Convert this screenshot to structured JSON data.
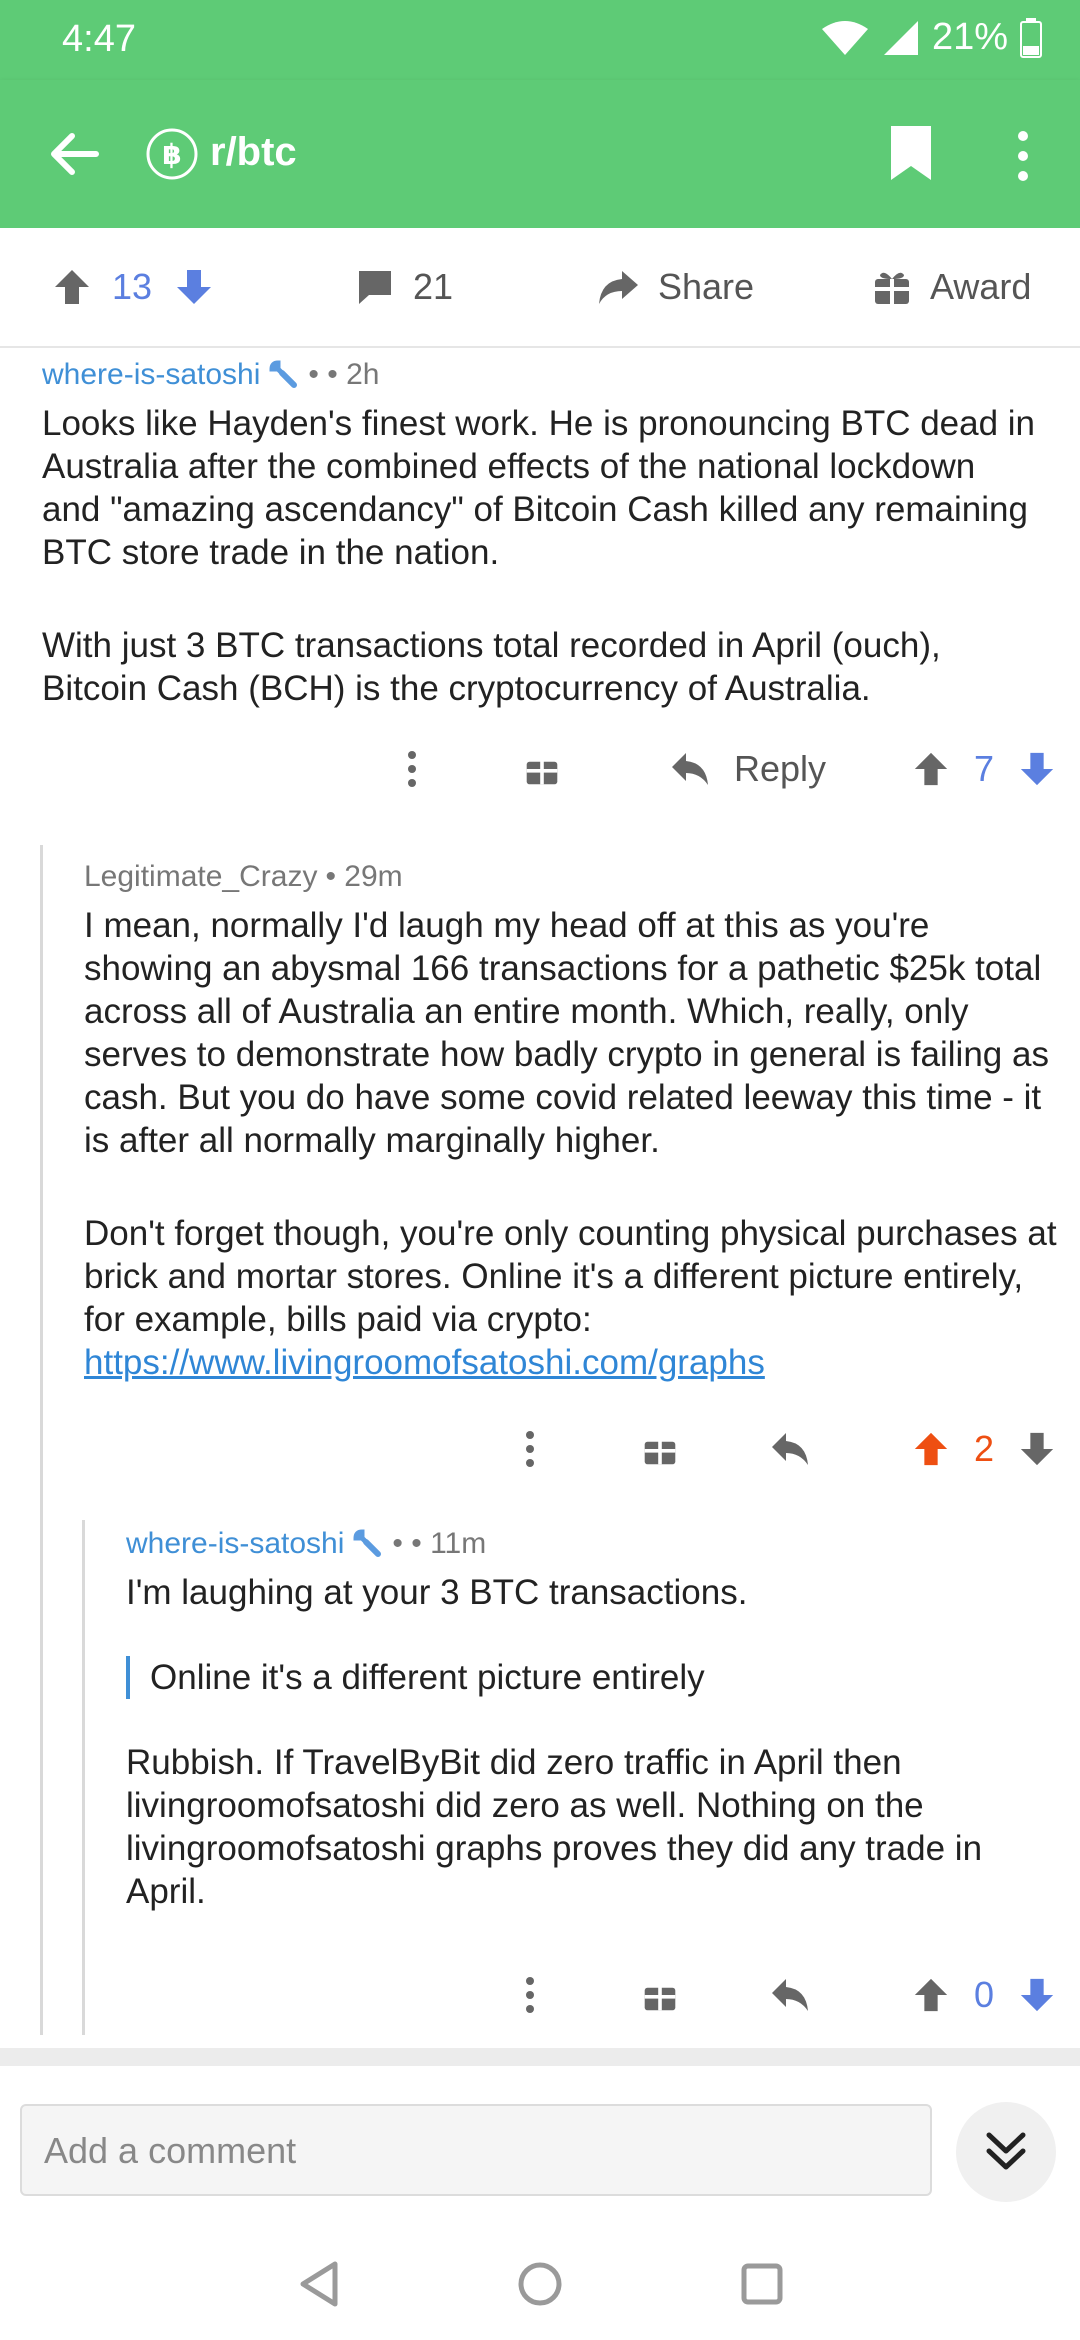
{
  "status_bar": {
    "time": "4:47",
    "battery": "21%"
  },
  "app_bar": {
    "title": "r/btc",
    "icon": "bitcoin-icon"
  },
  "post_actions": {
    "score": "13",
    "comments": "21",
    "share_label": "Share",
    "award_label": "Award"
  },
  "comments": [
    {
      "author": "where-is-satoshi",
      "flair_icon": "wrench-icon",
      "sep": "• • 2h",
      "paragraphs": [
        "Looks like Hayden's finest work. He is pronouncing BTC dead in Australia after the combined effects of the national lockdown and \"amazing ascendancy\" of Bitcoin Cash killed any remaining BTC store trade in the nation.",
        "With just 3 BTC transactions total recorded in April (ouch), Bitcoin Cash (BCH) is the cryptocurrency of Australia."
      ],
      "reply_label": "Reply",
      "score": "7"
    },
    {
      "author": "Legitimate_Crazy",
      "sep": "• 29m",
      "paragraphs": [
        "I mean, normally I'd laugh my head off at this as you're showing an abysmal 166 transactions for a pathetic $25k total across all of Australia an entire month. Which, really, only serves to demonstrate how badly crypto in general is failing as cash. But you do have some covid related leeway this time - it is after all normally marginally higher.",
        "Don't forget though, you're only counting physical purchases at brick and mortar stores. Online it's a different picture entirely, for example, bills paid via crypto:"
      ],
      "link": "https://www.livingroomofsatoshi.com/graphs",
      "score": "2",
      "upvoted": true
    },
    {
      "author": "where-is-satoshi",
      "flair_icon": "wrench-icon",
      "sep": "• • 11m",
      "line1": "I'm laughing at your 3 BTC transactions.",
      "quote": "Online it's a different picture entirely",
      "paragraph": "Rubbish. If TravelByBit did zero traffic in April then livingroomofsatoshi did zero as well. Nothing on the livingroomofsatoshi graphs proves they did any trade in April.",
      "score": "0"
    }
  ],
  "composer": {
    "placeholder": "Add a comment"
  },
  "colors": {
    "header": "#5ecb76",
    "upvote_active": "#ee4f12",
    "vote_blue": "#5b7fe0",
    "author_blue": "#3f8fd6"
  }
}
